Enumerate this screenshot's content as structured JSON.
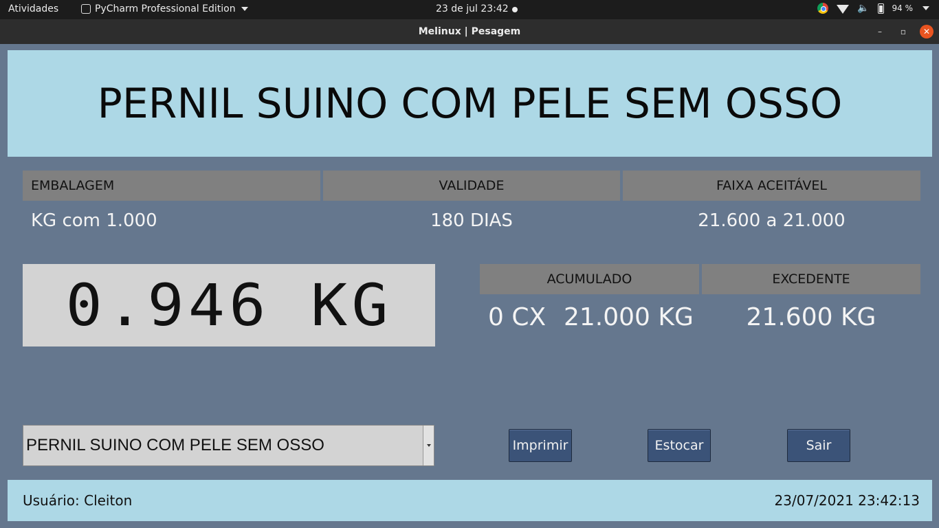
{
  "system_bar": {
    "activities": "Atividades",
    "app_name": "PyCharm Professional Edition",
    "clock": "23 de jul  23:42",
    "battery": "94 %"
  },
  "window": {
    "title": "Melinux | Pesagem",
    "minimize": "–",
    "maximize": "▫",
    "close": "✕"
  },
  "product": {
    "name": "PERNIL SUINO COM PELE SEM OSSO"
  },
  "info": {
    "embalagem_label": "EMBALAGEM",
    "embalagem_value": "KG com 1.000",
    "validade_label": "VALIDADE",
    "validade_value": "180 DIAS",
    "faixa_label": "FAIXA ACEITÁVEL",
    "faixa_value": "21.600 a 21.000"
  },
  "scale": {
    "reading": "0.946 KG"
  },
  "totals": {
    "acumulado_label": "ACUMULADO",
    "acumulado_boxes": "0 CX",
    "acumulado_weight": "21.000 KG",
    "excedente_label": "EXCEDENTE",
    "excedente_value": "21.600 KG"
  },
  "selector": {
    "selected": "PERNIL SUINO COM PELE SEM OSSO"
  },
  "actions": {
    "print": "Imprimir",
    "stock": "Estocar",
    "exit": "Sair"
  },
  "status": {
    "user": "Usuário: Cleiton",
    "datetime": "23/07/2021 23:42:13"
  }
}
